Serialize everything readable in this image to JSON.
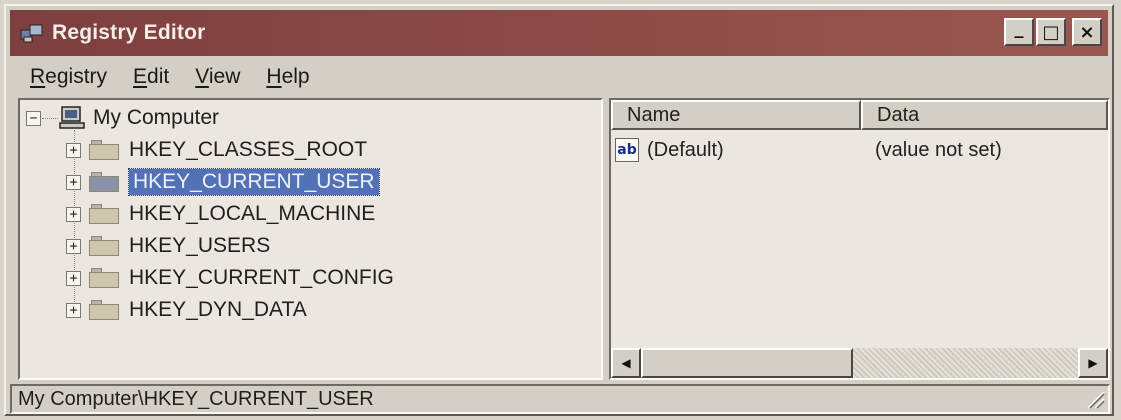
{
  "window": {
    "title": "Registry Editor",
    "icon": "regedit-icon",
    "controls": {
      "minimize": "_",
      "maximize": "□",
      "close": "×"
    }
  },
  "menu": {
    "items": [
      {
        "pre": "",
        "u": "R",
        "post": "egistry"
      },
      {
        "pre": "",
        "u": "E",
        "post": "dit"
      },
      {
        "pre": "",
        "u": "V",
        "post": "iew"
      },
      {
        "pre": "",
        "u": "H",
        "post": "elp"
      }
    ]
  },
  "tree": {
    "root": {
      "label": "My Computer",
      "expander": "−",
      "icon": "computer-icon"
    },
    "keys": [
      {
        "label": "HKEY_CLASSES_ROOT",
        "expander": "+",
        "selected": false
      },
      {
        "label": "HKEY_CURRENT_USER",
        "expander": "+",
        "selected": true
      },
      {
        "label": "HKEY_LOCAL_MACHINE",
        "expander": "+",
        "selected": false
      },
      {
        "label": "HKEY_USERS",
        "expander": "+",
        "selected": false
      },
      {
        "label": "HKEY_CURRENT_CONFIG",
        "expander": "+",
        "selected": false
      },
      {
        "label": "HKEY_DYN_DATA",
        "expander": "+",
        "selected": false
      }
    ]
  },
  "list": {
    "columns": [
      "Name",
      "Data"
    ],
    "rows": [
      {
        "icon": "ab",
        "name": "(Default)",
        "data": "(value not set)"
      }
    ],
    "scroll": {
      "left": "◀",
      "right": "▶"
    }
  },
  "status": {
    "path": "My Computer\\HKEY_CURRENT_USER"
  },
  "colors": {
    "title_bar": "#7d3f3f",
    "selection": "#5271b6",
    "face": "#d4cfc4"
  }
}
